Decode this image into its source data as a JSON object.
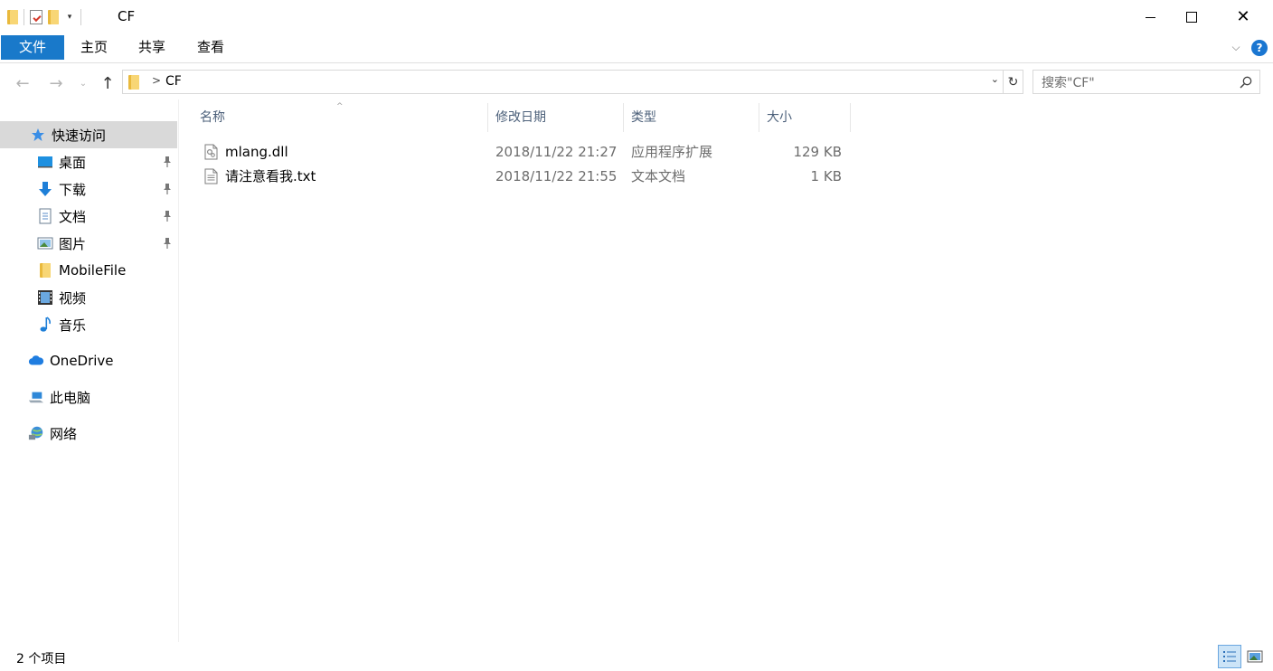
{
  "window": {
    "title": "CF",
    "minimize_glyph": "",
    "maximize_glyph": "",
    "close_glyph": "✕",
    "qat_dropdown_glyph": "▾"
  },
  "ribbon": {
    "tabs": [
      {
        "label": "文件",
        "active": true
      },
      {
        "label": "主页"
      },
      {
        "label": "共享"
      },
      {
        "label": "查看"
      }
    ],
    "expand_glyph": "⌵",
    "help_glyph": "?"
  },
  "navigation": {
    "back_glyph": "←",
    "forward_glyph": "→",
    "recent_glyph": "⌄",
    "up_glyph": "↑",
    "address": {
      "separator": ">",
      "path": "CF",
      "dropdown_glyph": "⌄"
    },
    "refresh_glyph": "↻",
    "search": {
      "placeholder": "搜索\"CF\"",
      "value": ""
    }
  },
  "sidebar": {
    "quick_access": {
      "label": "快速访问",
      "icon": "star-icon",
      "selected": true
    },
    "quick_items": [
      {
        "label": "桌面",
        "icon": "desktop-icon",
        "pinned": true
      },
      {
        "label": "下载",
        "icon": "download-icon",
        "pinned": true
      },
      {
        "label": "文档",
        "icon": "document-icon",
        "pinned": true
      },
      {
        "label": "图片",
        "icon": "pictures-icon",
        "pinned": true
      },
      {
        "label": "MobileFile",
        "icon": "folder-icon",
        "pinned": false
      },
      {
        "label": "视频",
        "icon": "video-icon",
        "pinned": false
      },
      {
        "label": "音乐",
        "icon": "music-icon",
        "pinned": false
      }
    ],
    "roots": [
      {
        "label": "OneDrive",
        "icon": "cloud-icon"
      },
      {
        "label": "此电脑",
        "icon": "computer-icon"
      },
      {
        "label": "网络",
        "icon": "network-icon"
      }
    ],
    "pin_glyph": "📌"
  },
  "columns": {
    "name": "名称",
    "date": "修改日期",
    "type": "类型",
    "size": "大小",
    "sort_glyph": "^"
  },
  "files": [
    {
      "name": "mlang.dll",
      "date": "2018/11/22 21:27",
      "type": "应用程序扩展",
      "size": "129 KB",
      "icon": "dll-file-icon"
    },
    {
      "name": "请注意看我.txt",
      "date": "2018/11/22 21:55",
      "type": "文本文档",
      "size": "1 KB",
      "icon": "text-file-icon"
    }
  ],
  "status": {
    "item_count": "2 个项目"
  },
  "colors": {
    "accent": "#1979ca",
    "selected_bg": "#d9d9d9",
    "header_text": "#4c607a",
    "secondary_text": "#6d6d6d"
  }
}
